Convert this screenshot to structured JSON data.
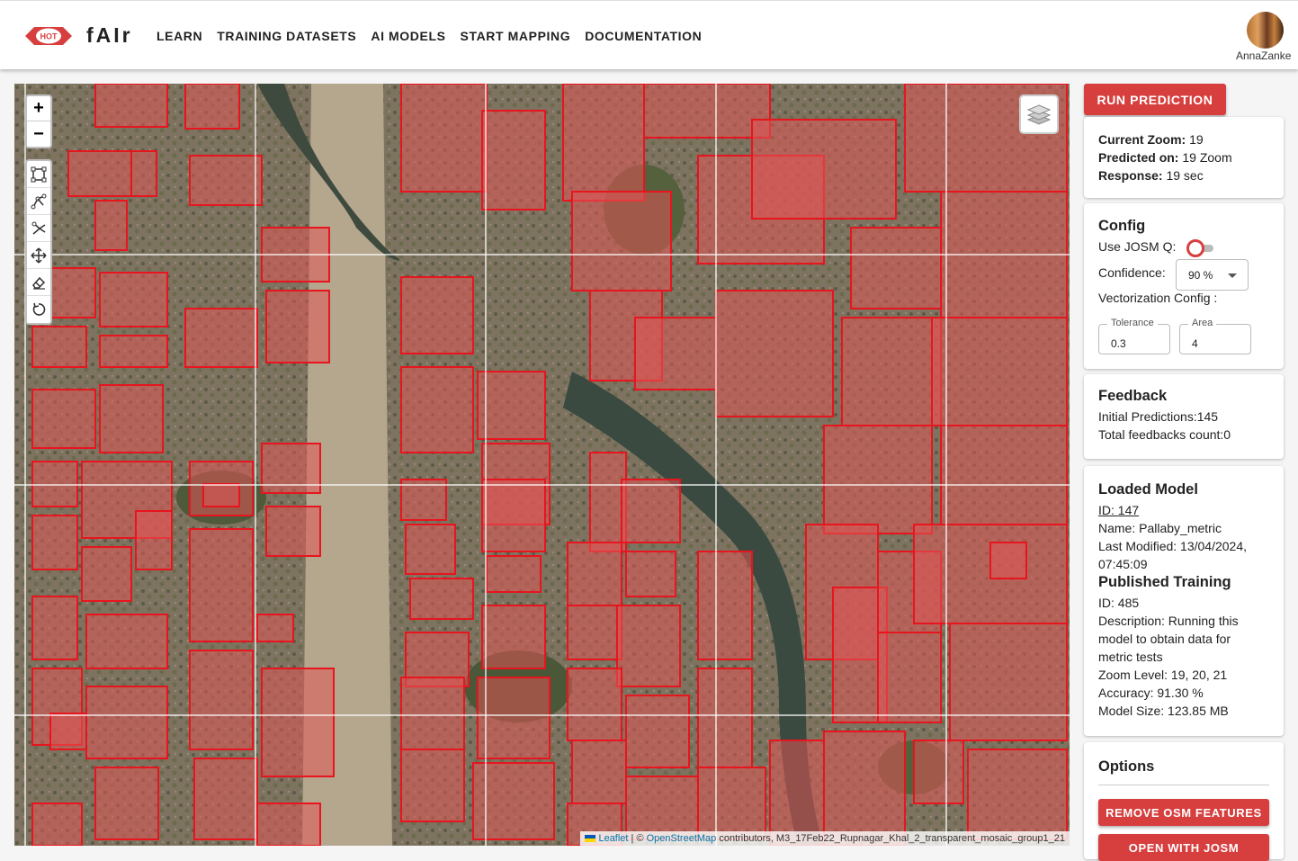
{
  "header": {
    "logo_text": "HOT",
    "brand": "fAIr",
    "nav": [
      "LEARN",
      "TRAINING DATASETS",
      "AI MODELS",
      "START MAPPING",
      "DOCUMENTATION"
    ],
    "username": "AnnaZanke"
  },
  "map": {
    "zoom_in": "+",
    "zoom_out": "−",
    "attribution": {
      "leaflet": "Leaflet",
      "sep": " | © ",
      "osm": "OpenStreetMap",
      "rest": " contributors, M3_17Feb22_Rupnagar_Khal_2_transparent_mosaic_group1_21"
    }
  },
  "sidebar": {
    "run_prediction": "RUN PREDICTION",
    "stats": {
      "current_zoom_label": "Current Zoom:",
      "current_zoom": " 19",
      "predicted_on_label": "Predicted on:",
      "predicted_on": " 19 Zoom",
      "response_label": "Response:",
      "response": " 19 sec"
    },
    "config": {
      "title": "Config",
      "josm_q_label": "Use JOSM Q:",
      "josm_q_enabled": false,
      "confidence_label": "Confidence:",
      "confidence_value": "90 %",
      "vectorization_label": "Vectorization Config :",
      "tolerance_label": "Tolerance",
      "tolerance_value": "0.3",
      "area_label": "Area",
      "area_value": "4"
    },
    "feedback": {
      "title": "Feedback",
      "initial_predictions": "Initial Predictions:145",
      "total_feedbacks": "Total feedbacks count:0"
    },
    "model": {
      "title": "Loaded Model",
      "id_link": "ID: 147",
      "name": "Name: Pallaby_metric",
      "last_modified_1": "Last Modified: 13/04/2024,",
      "last_modified_2": "07:45:09",
      "published_title": "Published Training",
      "published_id": "ID: 485",
      "desc_1": "Description: Running this",
      "desc_2": "model to obtain data for",
      "desc_3": "metric tests",
      "zoom_level": "Zoom Level: 19, 20, 21",
      "accuracy": "Accuracy: 91.30 %",
      "model_size": "Model Size: 123.85 MB"
    },
    "options": {
      "title": "Options",
      "remove_osm": "REMOVE OSM FEATURES",
      "open_josm": "OPEN WITH JOSM"
    }
  },
  "colors": {
    "accent": "#d73f3f",
    "prediction_fill": "#e0555580",
    "prediction_stroke": "#e8141e"
  }
}
